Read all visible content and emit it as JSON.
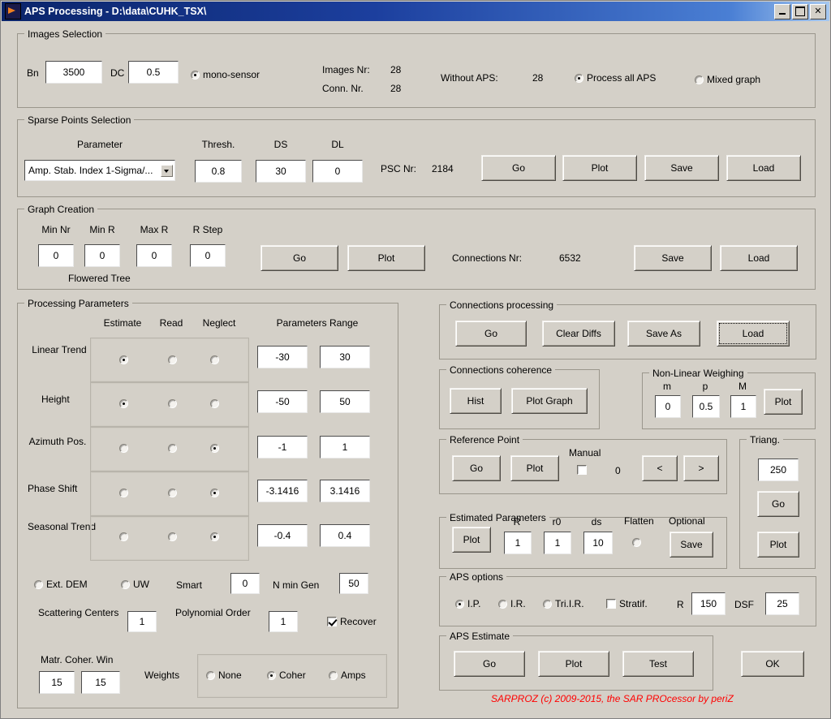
{
  "window": {
    "title": "APS Processing - D:\\data\\CUHK_TSX\\",
    "icon": "matlab-figure-icon",
    "minimize": "minimize-icon",
    "maximize": "maximize-icon",
    "close": "✕"
  },
  "images_selection": {
    "legend": "Images Selection",
    "bn_label": "Bn",
    "bn_value": "3500",
    "dc_label": "DC",
    "dc_value": "0.5",
    "mono_sensor": {
      "label": "mono-sensor",
      "checked": true
    },
    "images_nr_label": "Images Nr:",
    "images_nr_value": "28",
    "conn_nr_label": "Conn. Nr.",
    "conn_nr_value": "28",
    "without_aps_label": "Without APS:",
    "without_aps_value": "28",
    "process_all_aps": {
      "label": "Process all APS",
      "checked": true
    },
    "mixed_graph": {
      "label": "Mixed graph",
      "checked": false
    }
  },
  "sparse_points": {
    "legend": "Sparse Points Selection",
    "parameter_label": "Parameter",
    "parameter_value": "Amp. Stab. Index 1-Sigma/...",
    "thresh_label": "Thresh.",
    "thresh_value": "0.8",
    "ds_label": "DS",
    "ds_value": "30",
    "dl_label": "DL",
    "dl_value": "0",
    "psc_nr_label": "PSC Nr:",
    "psc_nr_value": "2184",
    "go": "Go",
    "plot": "Plot",
    "save": "Save",
    "load": "Load"
  },
  "graph_creation": {
    "legend": "Graph Creation",
    "min_nr_label": "Min Nr",
    "min_nr_value": "0",
    "min_r_label": "Min R",
    "min_r_value": "0",
    "max_r_label": "Max R",
    "max_r_value": "0",
    "r_step_label": "R Step",
    "r_step_value": "0",
    "flowered_tree_label": "Flowered Tree",
    "go": "Go",
    "plot": "Plot",
    "connections_nr_label": "Connections Nr:",
    "connections_nr_value": "6532",
    "save": "Save",
    "load": "Load"
  },
  "processing_parameters": {
    "legend": "Processing Parameters",
    "col_estimate": "Estimate",
    "col_read": "Read",
    "col_neglect": "Neglect",
    "col_range": "Parameters Range",
    "rows": [
      {
        "name": "Linear Trend",
        "mode": "estimate",
        "min": "-30",
        "max": "30"
      },
      {
        "name": "Height",
        "mode": "estimate",
        "min": "-50",
        "max": "50"
      },
      {
        "name": "Azimuth Pos.",
        "mode": "neglect",
        "min": "-1",
        "max": "1"
      },
      {
        "name": "Phase Shift",
        "mode": "neglect",
        "min": "-3.1416",
        "max": "3.1416"
      },
      {
        "name": "Seasonal Trend",
        "mode": "neglect",
        "min": "-0.4",
        "max": "0.4"
      }
    ],
    "ext_dem": {
      "label": "Ext. DEM",
      "checked": false
    },
    "uw": {
      "label": "UW",
      "checked": false
    },
    "smart_label": "Smart",
    "smart_value": "0",
    "n_min_gen_label": "N min Gen",
    "n_min_gen_value": "50",
    "scattering_centers_label": "Scattering Centers",
    "scattering_centers_value": "1",
    "polynomial_order_label": "Polynomial Order",
    "polynomial_order_value": "1",
    "recover": {
      "label": "Recover",
      "checked": true
    },
    "matr_coher_win_label": "Matr. Coher. Win",
    "matr_coher_win_1": "15",
    "matr_coher_win_2": "15",
    "weights_label": "Weights",
    "weights_none": {
      "label": "None",
      "checked": false
    },
    "weights_coher": {
      "label": "Coher",
      "checked": true
    },
    "weights_amps": {
      "label": "Amps",
      "checked": false
    }
  },
  "connections_processing": {
    "legend": "Connections processing",
    "go": "Go",
    "clear_diffs": "Clear Diffs",
    "save_as": "Save As",
    "load": "Load"
  },
  "connections_coherence": {
    "legend": "Connections coherence",
    "hist": "Hist",
    "plot_graph": "Plot Graph"
  },
  "non_linear_weighing": {
    "legend": "Non-Linear Weighing",
    "m_label": "m",
    "m_value": "0",
    "p_label": "p",
    "p_value": "0.5",
    "M_label": "M",
    "M_value": "1",
    "plot": "Plot"
  },
  "reference_point": {
    "legend": "Reference Point",
    "go": "Go",
    "plot": "Plot",
    "manual_label": "Manual",
    "manual_checked": false,
    "index_value": "0",
    "prev": "<",
    "next": ">"
  },
  "triang": {
    "legend": "Triang.",
    "value": "250",
    "go": "Go",
    "plot": "Plot"
  },
  "estimated_parameters": {
    "legend": "Estimated Parameters",
    "plot": "Plot",
    "r_label": "R",
    "r_value": "1",
    "r0_label": "r0",
    "r0_value": "1",
    "ds_label": "ds",
    "ds_value": "10",
    "flatten_label": "Flatten",
    "flatten_checked": false,
    "optional_label": "Optional",
    "save": "Save"
  },
  "aps_options": {
    "legend": "APS options",
    "ip": {
      "label": "I.P.",
      "checked": true
    },
    "ir": {
      "label": "I.R.",
      "checked": false
    },
    "triir": {
      "label": "Tri.I.R.",
      "checked": false
    },
    "stratif": {
      "label": "Stratif.",
      "checked": false
    },
    "r_label": "R",
    "r_value": "150",
    "dsf_label": "DSF",
    "dsf_value": "25"
  },
  "aps_estimate": {
    "legend": "APS Estimate",
    "go": "Go",
    "plot": "Plot",
    "test": "Test"
  },
  "ok_button": "OK",
  "footer": "SARPROZ (c) 2009-2015, the SAR PROcessor by periZ"
}
